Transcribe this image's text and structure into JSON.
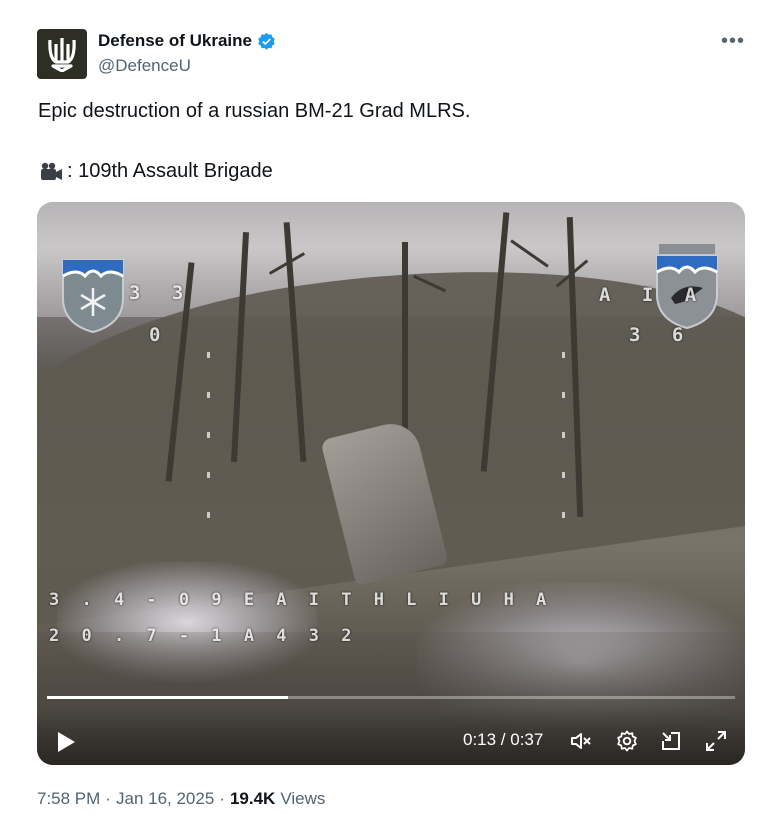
{
  "tweet": {
    "author_name": "Defense of Ukraine",
    "handle": "@DefenceU",
    "text_line1": "Epic destruction of a russian BM-21 Grad MLRS.",
    "camera_emoji_icon": "video-camera-icon",
    "text_line2": ": 109th Assault Brigade",
    "verified_icon": "verified-badge-icon",
    "more_label": "•••",
    "verified_color": "#1d9bf0"
  },
  "video": {
    "osd": {
      "left_top": "3 3",
      "left_mid": "0",
      "right_top": "A I A",
      "right_mid": "3 6",
      "bottom_row1": "3 . 4 - 0 9  E A I T H L I U H A",
      "bottom_row2": "2 0 . 7 - 1 A 4 3 2"
    },
    "time_display": "0:13 / 0:37",
    "progress": 0.351,
    "controls": {
      "play": "play-icon",
      "mute": "muted-speaker-icon",
      "settings": "gear-icon",
      "pip": "picture-in-picture-icon",
      "fullscreen": "fullscreen-icon"
    }
  },
  "footer": {
    "time": "7:58 PM",
    "separator1": "·",
    "date": "Jan 16, 2025",
    "separator2": "·",
    "views_count": "19.4K",
    "views_label": "Views"
  }
}
